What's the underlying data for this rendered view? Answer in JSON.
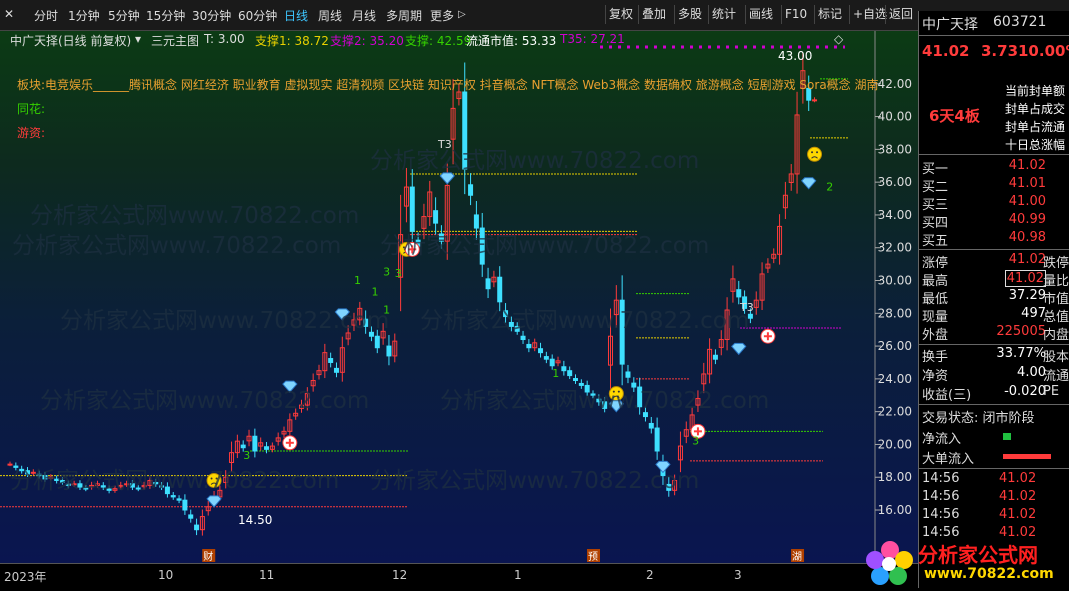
{
  "toolbar": {
    "periods": [
      "分时",
      "1分钟",
      "5分钟",
      "15分钟",
      "30分钟",
      "60分钟",
      "日线",
      "周线",
      "月线",
      "多周期",
      "更多"
    ],
    "more_arrow": "▷",
    "active_period": "日线",
    "buttons": [
      "复权",
      "叠加",
      "多股",
      "统计",
      "画线",
      "F10",
      "标记",
      "+自选",
      "返回"
    ]
  },
  "chart": {
    "title": "中广天择(日线 前复权)",
    "indicator_name": "三元主图",
    "t_value": "T: 3.00",
    "support1": "支撑1: 38.72",
    "support2": "支撑2: 35.20",
    "support_value": "支撑: 42.59",
    "float_cap": "流通市值: 53.33",
    "t35": "T35: 27.21",
    "concepts": "板块:电竞娱乐______腾讯概念 网红经济 职业教育 虚拟现实 超清视频 区块链 知识产权 抖音概念 NFT概念 Web3概念 数据确权 旅游概念 短剧游戏 Sora概念 湖南",
    "tonghua_label": "同花:",
    "youzi_label": "游资:",
    "watermark": "分析家公式网www.70822.com",
    "high_label": "43.00",
    "low_label": "14.50",
    "t3_label": "T3",
    "colors": {
      "up": "#ff3b3b",
      "down": "#3ee0ff",
      "yellow": "#e8d000",
      "green": "#35d000",
      "magenta": "#d000d0"
    },
    "y_ticks": [
      "42.00",
      "40.00",
      "38.00",
      "36.00",
      "34.00",
      "32.00",
      "30.00",
      "28.00",
      "26.00",
      "24.00",
      "22.00",
      "20.00",
      "18.00",
      "16.00"
    ],
    "chart_data": {
      "type": "candlestick",
      "y_range": [
        13.5,
        44.0
      ],
      "y_ticks": [
        42,
        40,
        38,
        36,
        34,
        32,
        30,
        28,
        26,
        24,
        22,
        20,
        18,
        16
      ],
      "x_labels": [
        "2023年",
        "10",
        "11",
        "12",
        "1",
        "2",
        "3"
      ],
      "closes": [
        18.8,
        18.6,
        18.4,
        18.2,
        18.3,
        18.1,
        17.9,
        18.0,
        17.8,
        17.7,
        17.5,
        17.6,
        17.4,
        17.3,
        17.5,
        17.6,
        17.4,
        17.2,
        17.3,
        17.5,
        17.6,
        17.4,
        17.3,
        17.5,
        17.8,
        17.6,
        17.4,
        17.0,
        16.8,
        16.6,
        16.0,
        15.5,
        14.8,
        15.6,
        16.2,
        16.8,
        17.2,
        18.0,
        19.5,
        20.2,
        19.8,
        20.5,
        19.6,
        20.1,
        19.7,
        19.9,
        20.4,
        20.8,
        21.5,
        21.9,
        22.4,
        23.1,
        23.9,
        24.5,
        25.6,
        25.0,
        24.4,
        25.9,
        26.8,
        27.6,
        28.3,
        27.2,
        26.6,
        25.9,
        26.9,
        25.4,
        26.3,
        32.8,
        35.7,
        33.0,
        32.1,
        33.9,
        35.4,
        33.5,
        32.4,
        35.8,
        40.5,
        41.5,
        36.8,
        35.2,
        33.2,
        31.0,
        29.5,
        30.2,
        28.7,
        27.8,
        27.2,
        26.9,
        26.4,
        25.9,
        26.2,
        25.6,
        25.2,
        24.8,
        25.1,
        24.5,
        24.2,
        23.9,
        23.6,
        23.2,
        23.0,
        22.6,
        22.2,
        26.6,
        28.8,
        24.9,
        24.1,
        23.5,
        22.3,
        21.7,
        21.0,
        19.6,
        18.1,
        17.2,
        17.8,
        19.9,
        20.9,
        21.8,
        22.8,
        24.3,
        25.8,
        25.2,
        26.4,
        28.2,
        30.1,
        29.0,
        28.3,
        27.7,
        28.8,
        30.4,
        31.0,
        31.6,
        33.3,
        35.2,
        36.5,
        40.1,
        42.8,
        41.0,
        41.02
      ]
    },
    "levels": [
      {
        "value": 36.5,
        "x0": 410,
        "x1": 638,
        "color": "#e8d000"
      },
      {
        "value": 33.0,
        "x0": 410,
        "x1": 638,
        "color": "#e8d000"
      },
      {
        "value": 32.8,
        "x0": 410,
        "x1": 638,
        "color": "#ff3b3b"
      },
      {
        "value": 29.2,
        "x0": 636,
        "x1": 690,
        "color": "#35d000"
      },
      {
        "value": 26.5,
        "x0": 636,
        "x1": 690,
        "color": "#e8d000"
      },
      {
        "value": 24.0,
        "x0": 636,
        "x1": 690,
        "color": "#ff3b3b"
      },
      {
        "value": 27.1,
        "x0": 740,
        "x1": 842,
        "color": "#d000d0"
      },
      {
        "value": 20.8,
        "x0": 690,
        "x1": 823,
        "color": "#35d000"
      },
      {
        "value": 19.0,
        "x0": 690,
        "x1": 823,
        "color": "#ff3b3b"
      },
      {
        "value": 19.6,
        "x0": 250,
        "x1": 408,
        "color": "#35d000"
      },
      {
        "value": 18.1,
        "x0": 0,
        "x1": 408,
        "color": "#e8d000"
      },
      {
        "value": 16.2,
        "x0": 0,
        "x1": 408,
        "color": "#ff3b3b"
      },
      {
        "value": 42.3,
        "x0": 820,
        "x1": 848,
        "color": "#35d000"
      },
      {
        "value": 38.7,
        "x0": 810,
        "x1": 848,
        "color": "#e8d000"
      }
    ],
    "markers": [
      {
        "kind": "diamond",
        "i": 35,
        "value": 16.5
      },
      {
        "kind": "face",
        "i": 35,
        "value": 17.8
      },
      {
        "kind": "diamond",
        "i": 48,
        "value": 23.5
      },
      {
        "kind": "plus",
        "i": 48,
        "value": 20.1
      },
      {
        "kind": "diamond",
        "i": 57,
        "value": 27.9
      },
      {
        "kind": "face",
        "i": 68,
        "value": 31.9
      },
      {
        "kind": "plus",
        "i": 69,
        "value": 31.9
      },
      {
        "kind": "diamond",
        "i": 75,
        "value": 36.2
      },
      {
        "kind": "face",
        "i": 104,
        "value": 23.1
      },
      {
        "kind": "diamond",
        "i": 104,
        "value": 22.3
      },
      {
        "kind": "diamond",
        "i": 112,
        "value": 18.6
      },
      {
        "kind": "plus",
        "i": 118,
        "value": 20.8
      },
      {
        "kind": "diamond",
        "i": 125,
        "value": 25.8
      },
      {
        "kind": "plus",
        "i": 130,
        "value": 26.6
      },
      {
        "kind": "diamond",
        "i": 137,
        "value": 35.9
      },
      {
        "kind": "face",
        "i": 138,
        "value": 37.7
      }
    ],
    "digits": [
      {
        "t": "3",
        "i": 40,
        "value": 19.1
      },
      {
        "t": "1",
        "i": 59,
        "value": 29.8
      },
      {
        "t": "1",
        "i": 62,
        "value": 29.1
      },
      {
        "t": "1",
        "i": 64,
        "value": 28.0
      },
      {
        "t": "3",
        "i": 64,
        "value": 30.3
      },
      {
        "t": "3",
        "i": 66,
        "value": 30.2
      },
      {
        "t": "1",
        "i": 93,
        "value": 24.1
      },
      {
        "t": "3",
        "i": 117,
        "value": 20.0
      },
      {
        "t": "2",
        "i": 140,
        "value": 35.5
      }
    ],
    "bottom_tags": [
      {
        "text": "财",
        "i": 34
      },
      {
        "text": "预",
        "i": 100
      },
      {
        "text": "湖",
        "i": 135
      }
    ]
  },
  "quote": {
    "name": "中广天择",
    "code": "603721",
    "price": "41.02",
    "change": "3.73",
    "pct": "10.00%",
    "streak": "6天4板",
    "seal_notes": [
      "当前封单额",
      "封单占成交",
      "封单占流通",
      "十日总涨幅"
    ],
    "bids": [
      {
        "label": "买一",
        "price": "41.02"
      },
      {
        "label": "买二",
        "price": "41.01"
      },
      {
        "label": "买三",
        "price": "41.00"
      },
      {
        "label": "买四",
        "price": "40.99"
      },
      {
        "label": "买五",
        "price": "40.98"
      }
    ],
    "stats": [
      {
        "label": "涨停",
        "value": "41.02",
        "extra": "跌停"
      },
      {
        "label": "最高",
        "value": "41.02",
        "extra": "量比"
      },
      {
        "label": "最低",
        "value": "37.29",
        "extra": "市值"
      },
      {
        "label": "现量",
        "value": "497",
        "extra": "总值"
      },
      {
        "label": "外盘",
        "value": "225005",
        "extra": "内盘"
      }
    ],
    "stats2": [
      {
        "label": "换手",
        "value": "33.77%",
        "extra": "股本"
      },
      {
        "label": "净资",
        "value": "4.00",
        "extra": "流通"
      },
      {
        "label": "收益(三)",
        "value": "-0.020",
        "extra": "PE"
      }
    ],
    "trade_state": "交易状态: 闭市阶段",
    "net_inflow": "净流入",
    "big_inflow": "大单流入",
    "ticks": [
      {
        "time": "14:56",
        "price": "41.02"
      },
      {
        "time": "14:56",
        "price": "41.02"
      },
      {
        "time": "14:56",
        "price": "41.02"
      },
      {
        "time": "14:56",
        "price": "41.02"
      }
    ]
  },
  "logo": {
    "title": "分析家公式网",
    "url": "www.70822.com"
  }
}
